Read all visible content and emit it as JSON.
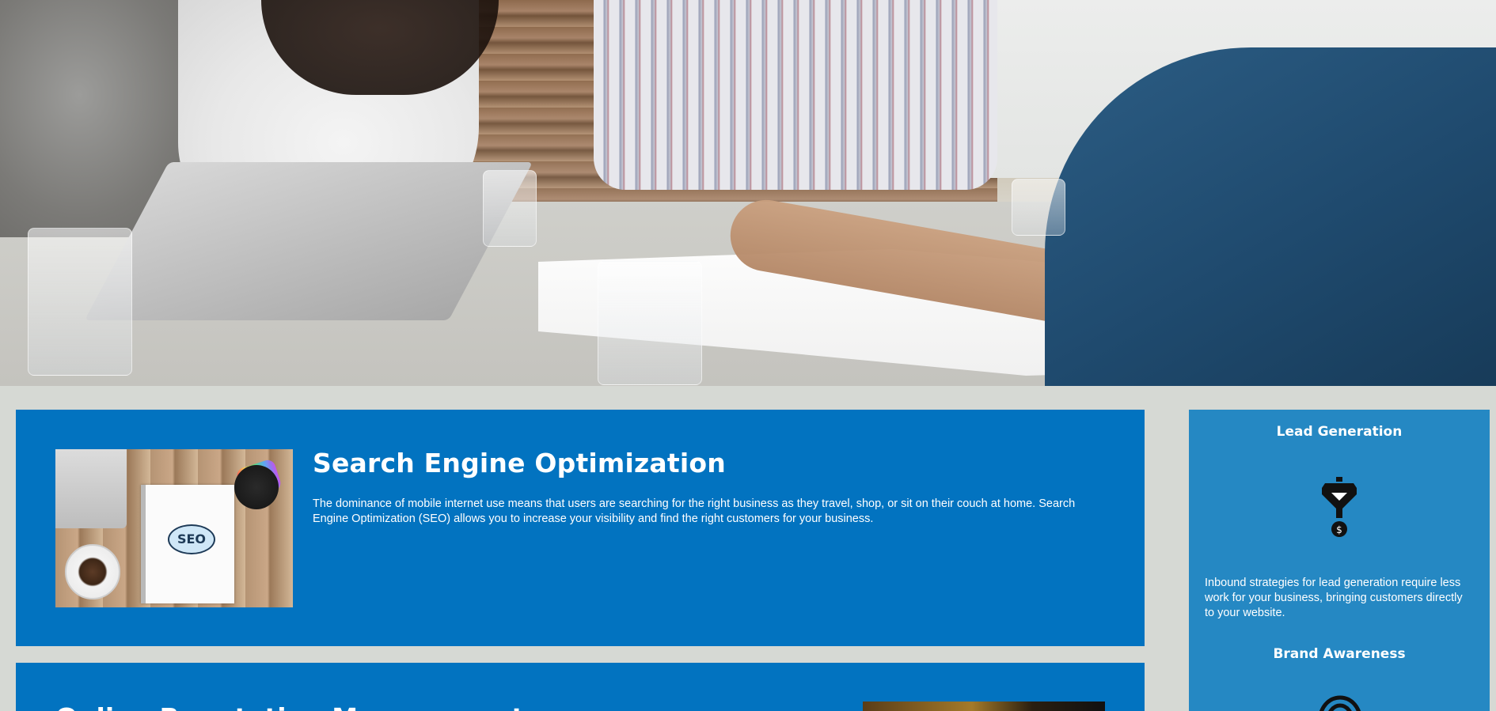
{
  "hero": {
    "alt": "Team meeting at a table"
  },
  "services": [
    {
      "title": "Search Engine Optimization",
      "body": "The dominance of mobile internet use means that users are searching for the right business as they travel, shop, or sit on their couch at home. Search Engine Optimization (SEO) allows you to increase your visibility and find the right customers for your business.",
      "image": {
        "seo_label": "SEO"
      }
    },
    {
      "title": "Online Reputation Management"
    }
  ],
  "sidebar": {
    "items": [
      {
        "title": "Lead Generation",
        "icon": "lead-generation-funnel-icon",
        "text": "Inbound strategies for lead generation require less work for your business, bringing customers directly to your website."
      },
      {
        "title": "Brand Awareness",
        "icon": "brand-awareness-broadcast-icon"
      }
    ]
  },
  "colors": {
    "page_bg": "#d6d9d4",
    "card_bg": "#0273c0",
    "sidebar_bg": "#2588c3",
    "text": "#ffffff"
  }
}
